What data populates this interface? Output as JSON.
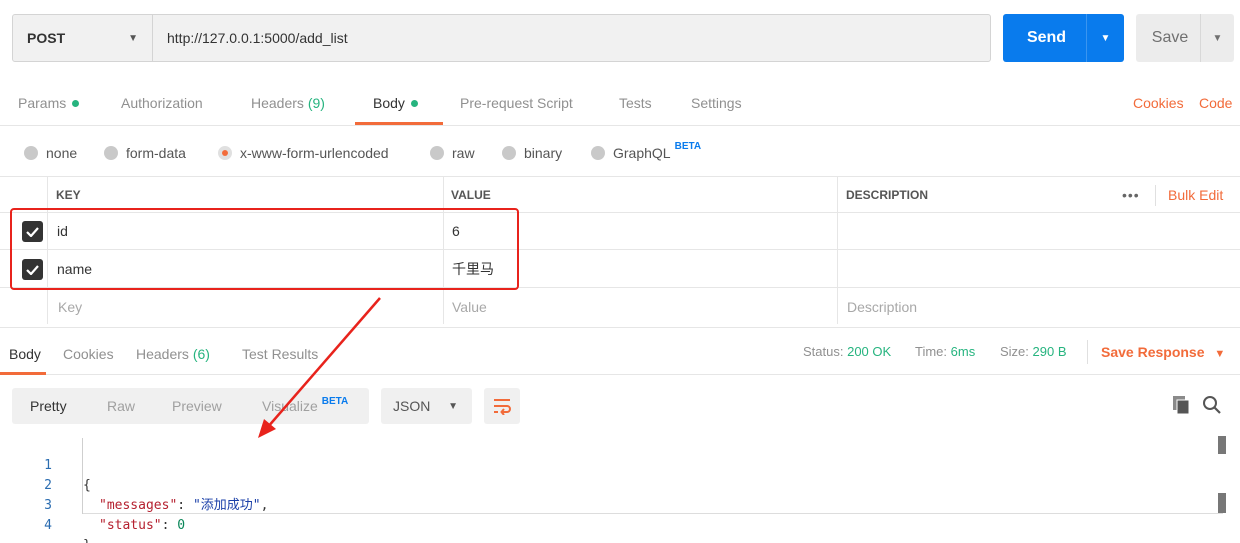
{
  "request": {
    "method": "POST",
    "url": "http://127.0.0.1:5000/add_list",
    "send_label": "Send",
    "save_label": "Save"
  },
  "request_tabs": {
    "params": "Params",
    "authorization": "Authorization",
    "headers": "Headers",
    "headers_count": "(9)",
    "body": "Body",
    "pre_request": "Pre-request Script",
    "tests": "Tests",
    "settings": "Settings",
    "cookies": "Cookies",
    "code": "Code"
  },
  "body_types": {
    "none": "none",
    "form_data": "form-data",
    "urlencoded": "x-www-form-urlencoded",
    "raw": "raw",
    "binary": "binary",
    "graphql": "GraphQL",
    "beta": "BETA",
    "selected": "x-www-form-urlencoded"
  },
  "params_table": {
    "headers": {
      "key": "KEY",
      "value": "VALUE",
      "description": "DESCRIPTION",
      "more": "•••",
      "bulk_edit": "Bulk Edit"
    },
    "rows": [
      {
        "key": "id",
        "value": "6",
        "checked": true
      },
      {
        "key": "name",
        "value": "千里马",
        "checked": true
      }
    ],
    "placeholders": {
      "key": "Key",
      "value": "Value",
      "description": "Description"
    }
  },
  "response_tabs": {
    "body": "Body",
    "cookies": "Cookies",
    "headers": "Headers",
    "headers_count": "(6)",
    "test_results": "Test Results"
  },
  "response_meta": {
    "status_label": "Status:",
    "status": "200 OK",
    "time_label": "Time:",
    "time": "6ms",
    "size_label": "Size:",
    "size": "290 B",
    "save_response": "Save Response"
  },
  "response_view": {
    "pretty": "Pretty",
    "raw": "Raw",
    "preview": "Preview",
    "visualize": "Visualize",
    "beta": "BETA",
    "format": "JSON"
  },
  "response_code": {
    "line_numbers": [
      "1",
      "2",
      "3",
      "4"
    ],
    "open_brace": "{",
    "messages_key": "\"messages\"",
    "messages_value": "\"添加成功\"",
    "status_key": "\"status\"",
    "status_value": "0",
    "close_brace": "}"
  },
  "colors": {
    "accent": "#f26b3a",
    "send": "#097bed",
    "success": "#26b47f",
    "highlight": "#e8231c"
  }
}
